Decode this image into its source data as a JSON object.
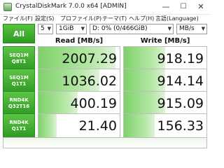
{
  "window": {
    "title": "CrystalDiskMark 7.0.0 x64 [ADMIN]",
    "minimize": "—",
    "maximize": "☐",
    "close": "✕"
  },
  "menu": [
    "ファイル(F)",
    "設定(S)",
    "プロファイル(P)",
    "テーマ(T)",
    "ヘルプ(H)",
    "言語(Language)"
  ],
  "controls": {
    "all_label": "All",
    "count": "5",
    "size": "1GiB",
    "drive": "D: 0% (0/466GiB)",
    "unit": "MB/s"
  },
  "headers": {
    "read": "Read [MB/s]",
    "write": "Write [MB/s]"
  },
  "tests": [
    {
      "name": "SEQ1M",
      "sub": "Q8T1",
      "read": "2007.29",
      "write": "918.19",
      "read_fill": 0.95,
      "write_fill": 0.5
    },
    {
      "name": "SEQ1M",
      "sub": "Q1T1",
      "read": "1036.02",
      "write": "914.14",
      "read_fill": 0.75,
      "write_fill": 0.5
    },
    {
      "name": "RND4K",
      "sub": "Q32T16",
      "read": "400.19",
      "write": "915.09",
      "read_fill": 0.48,
      "write_fill": 0.5
    },
    {
      "name": "RND4K",
      "sub": "Q1T1",
      "read": "21.40",
      "write": "156.33",
      "read_fill": 0.22,
      "write_fill": 0.37
    }
  ],
  "colors": {
    "accent_green": "#2f9a24",
    "bar_green": "#7fd16a"
  }
}
